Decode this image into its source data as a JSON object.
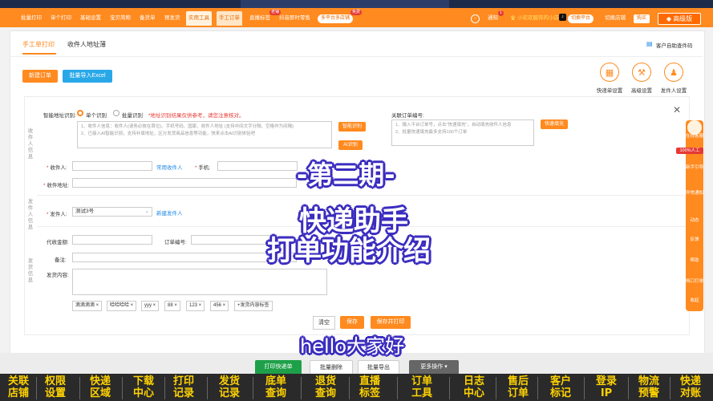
{
  "navbar": {
    "items": [
      "批量打印",
      "单个打印",
      "基础设置",
      "宝贝简称",
      "备货单",
      "预发货",
      "实用工具",
      "手工订单",
      "直播标签",
      "抖音即时零售"
    ],
    "live_badge": "老铺",
    "promo_pill": "多平台多店铺",
    "promo_badge": "免费",
    "notice_label": "通知",
    "notice_count": "1",
    "shop_name": "小欢欢服饰的小店",
    "switch_platform": "切换平台",
    "switch_shop": "切换店铺",
    "buy": "购买",
    "edition": "高级版"
  },
  "tabs": {
    "manual_print": "手工单打印",
    "address_book": "收件人地址薄"
  },
  "auto_query": "客户自助查件码",
  "buttons": {
    "new_order": "新建订单",
    "import_excel": "批量导入Excel"
  },
  "tools": [
    {
      "label": "快递单设置",
      "icon": "express-sheet-icon"
    },
    {
      "label": "高级设置",
      "icon": "tools-icon"
    },
    {
      "label": "发件人设置",
      "icon": "sender-icon"
    }
  ],
  "form": {
    "section_recipient": "收件人信息",
    "section_sender": "发件人信息",
    "section_shipping": "发货信息",
    "smart_label": "智能地址识别:",
    "mode_single": "单个识别",
    "mode_batch": "批量识别",
    "smart_hint": "*地址识别结果仅供参考，请您注意核对。",
    "smart_placeholder_1": "1、收件人信息：收件人(请务必放在首位)、手机号码、国家、收件人地址 (支持中间文字分隔、空格作为间隔)",
    "smart_placeholder_2": "2、已接入AI智能识别，支持补填地址，区分发货商品信息等功能，快来点击AI识别体验吧",
    "smart_button": "智能识别",
    "ai_button": "AI识别",
    "order_label": "关联订单编号:",
    "order_placeholder_1": "1、输入平台订单号，点击\"快速填充\"，自动填充收件人信息",
    "order_placeholder_2": "2、批量快速填充最多支持100个订单",
    "quick_fill": "快速填充",
    "recipient_label": "收件人:",
    "common_recipient": "常用收件人",
    "phone_label": "手机:",
    "address_label": "收件地址:",
    "sender_label": "发件人:",
    "sender_value": "测试3号",
    "new_sender": "新建发件人",
    "cod_label": "代收金额:",
    "order_no_label": "订单编号:",
    "remark_label": "备注:",
    "content_label": "发货内容:",
    "tags": [
      "滴滴滴滴",
      "哈哈哈哈",
      "yyy",
      "88",
      "123",
      "456"
    ],
    "add_tag": "+发货内容标签",
    "clear": "清空",
    "save": "保存",
    "save_print": "保存并打印"
  },
  "actions": {
    "print": "打印快递单",
    "batch_delete": "批量删除",
    "batch_export": "批量导出",
    "more": "更多操作"
  },
  "overlay": {
    "episode": "-第二期-",
    "title_1": "快递助手",
    "title_2": "打单功能介绍",
    "greeting": "hello大家好"
  },
  "right_panel": [
    "在线客服",
    "100%人工",
    "新手引导",
    "异常通知",
    "动态",
    "反馈",
    "帮助",
    "档口打单",
    "收起"
  ],
  "features": [
    [
      "关联",
      "店铺"
    ],
    [
      "权限",
      "设置"
    ],
    [
      "快递",
      "区域"
    ],
    [
      "下载",
      "中心"
    ],
    [
      "打印",
      "记录"
    ],
    [
      "发货",
      "记录"
    ],
    [
      "底单",
      "查询"
    ],
    [
      "退货",
      "查询"
    ],
    [
      "直播",
      "标签"
    ],
    [
      "订单",
      "工具"
    ],
    [
      "日志",
      "中心"
    ],
    [
      "售后",
      "订单"
    ],
    [
      "客户",
      "标记"
    ],
    [
      "登录",
      "IP"
    ],
    [
      "物流",
      "预警"
    ],
    [
      "快递",
      "对账"
    ]
  ]
}
